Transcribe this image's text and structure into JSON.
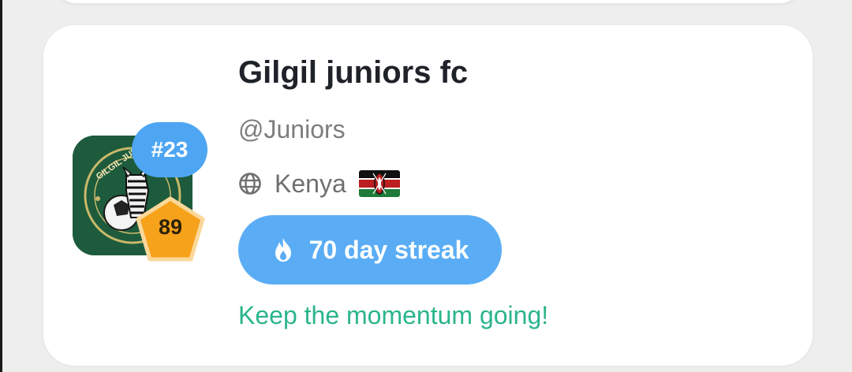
{
  "profile": {
    "name": "Gilgil juniors fc",
    "handle": "@Juniors",
    "country": "Kenya",
    "rank": "#23",
    "level": "89",
    "streak_label": "70 day streak",
    "encouragement": "Keep the momentum going!",
    "logo_text": "GILGIL JUNIORS"
  },
  "icons": {
    "location": "globe-icon",
    "flag": "kenya-flag-icon",
    "streak": "flame-icon",
    "level": "pentagon-badge-icon"
  },
  "colors": {
    "title": "#1f2229",
    "handle": "#7d7d7f",
    "rank_badge": "#4ea6f3",
    "level_badge": "#f7a21b",
    "streak_pill": "#5aadf5",
    "encouragement": "#2bb58c",
    "logo_background": "#1d5b3c"
  }
}
